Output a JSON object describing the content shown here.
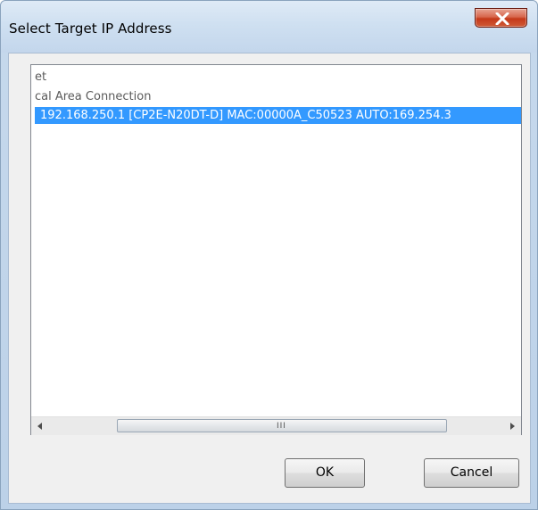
{
  "window": {
    "title": "Select Target IP Address"
  },
  "tree": {
    "items": [
      {
        "label": "et"
      },
      {
        "label": "cal Area Connection"
      },
      {
        "label": "192.168.250.1 [CP2E-N20DT-D] MAC:00000A_C50523 AUTO:169.254.3",
        "selected": true
      }
    ]
  },
  "scrollbar": {
    "grip": "III"
  },
  "buttons": {
    "ok_label": "OK",
    "cancel_label": "Cancel"
  },
  "colors": {
    "selection": "#3399ff",
    "close_button": "#c5391a"
  },
  "icons": {
    "close": "close-icon",
    "scroll_left": "arrow-left-icon",
    "scroll_right": "arrow-right-icon"
  }
}
